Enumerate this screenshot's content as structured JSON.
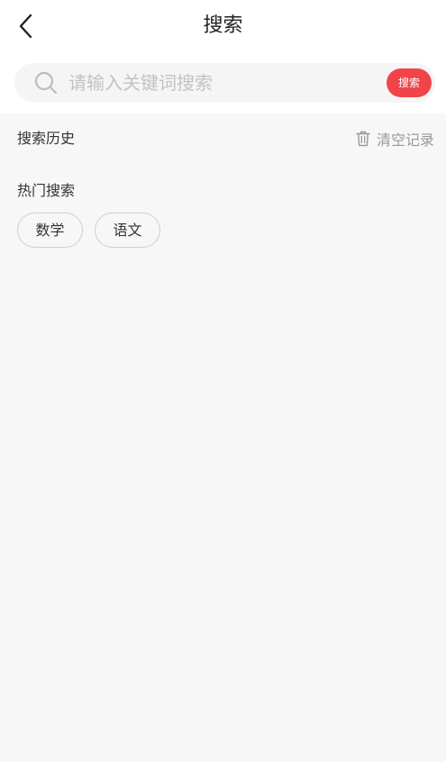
{
  "header": {
    "title": "搜索",
    "back_icon": "chevron-left-icon"
  },
  "search": {
    "placeholder": "请输入关键词搜索",
    "value": "",
    "button_label": "搜索",
    "icon": "search-icon",
    "button_color": "#f0444a"
  },
  "history": {
    "title": "搜索历史",
    "clear_label": "清空记录",
    "clear_icon": "trash-icon",
    "items": []
  },
  "hot": {
    "title": "热门搜索",
    "tags": [
      "数学",
      "语文"
    ]
  }
}
